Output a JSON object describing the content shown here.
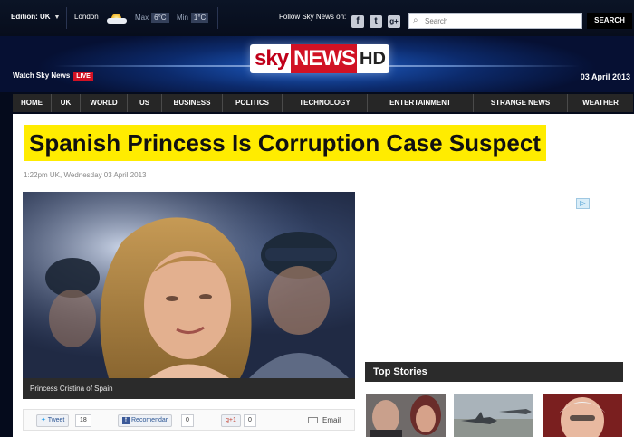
{
  "topbar": {
    "edition_label": "Edition: UK",
    "city": "London",
    "max_label": "Max",
    "max_value": "6°C",
    "min_label": "Min",
    "min_value": "1°C",
    "follow_label": "Follow Sky News on:",
    "social_icons": [
      "facebook-icon",
      "twitter-icon",
      "google-plus-icon"
    ],
    "search_placeholder": "Search",
    "search_button": "SEARCH"
  },
  "masthead": {
    "logo_sky": "sky",
    "logo_news": "NEWS",
    "logo_hd": "HD",
    "watch_label": "Watch Sky News",
    "live_badge": "LIVE",
    "date": "03 April 2013"
  },
  "nav": {
    "items": [
      "HOME",
      "UK",
      "WORLD",
      "US",
      "BUSINESS",
      "POLITICS",
      "TECHNOLOGY",
      "ENTERTAINMENT",
      "STRANGE NEWS",
      "WEATHER"
    ]
  },
  "article": {
    "headline": "Spanish Princess Is Corruption Case Suspect",
    "timestamp": "1:22pm UK, Wednesday 03 April 2013",
    "photo_caption": "Princess Cristina of Spain"
  },
  "share": {
    "tweet_label": "Tweet",
    "tweet_count": "18",
    "facebook_label": "Recomendar",
    "facebook_count": "0",
    "gplus_label": "+1",
    "gplus_count": "0",
    "email_label": "Email"
  },
  "sidebar": {
    "top_stories_title": "Top Stories"
  },
  "colors": {
    "headline_highlight": "#ffec00",
    "brand_red": "#d11224",
    "nav_bg": "#262626"
  }
}
